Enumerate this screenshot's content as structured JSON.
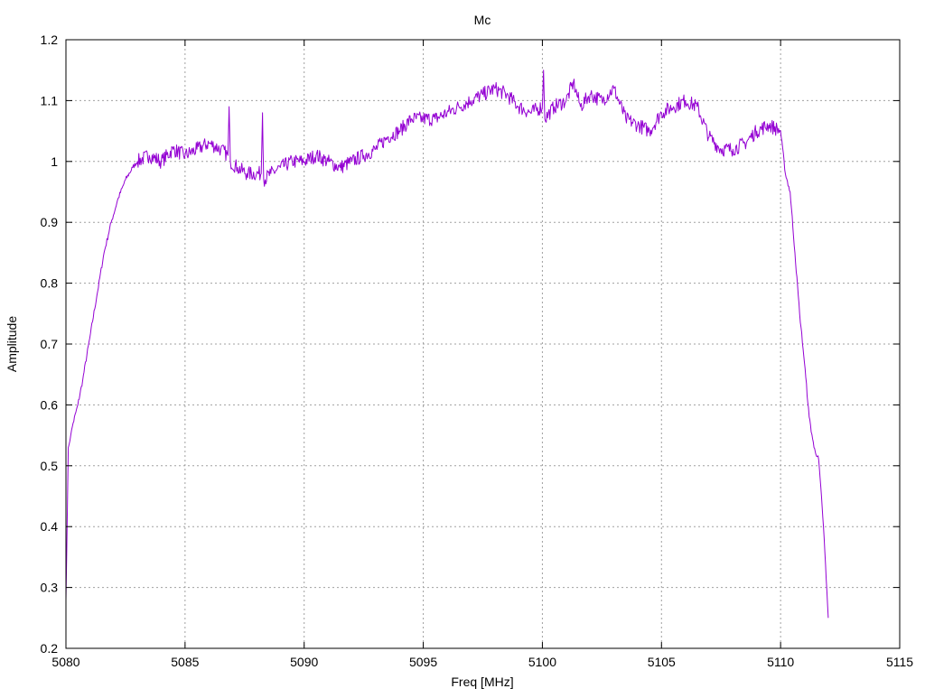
{
  "chart_data": {
    "type": "line",
    "title": "Mc",
    "xlabel": "Freq [MHz]",
    "ylabel": "Amplitude",
    "xlim": [
      5080,
      5115
    ],
    "ylim": [
      0.2,
      1.2
    ],
    "x_ticks": [
      5080,
      5085,
      5090,
      5095,
      5100,
      5105,
      5110,
      5115
    ],
    "y_ticks": [
      0.2,
      0.3,
      0.4,
      0.5,
      0.6,
      0.7,
      0.8,
      0.9,
      1.0,
      1.1,
      1.2
    ],
    "x_tick_labels": [
      "5080",
      "5085",
      "5090",
      "5095",
      "5100",
      "5105",
      "5110",
      "5115"
    ],
    "y_tick_labels": [
      "0.2",
      "0.3",
      "0.4",
      "0.5",
      "0.6",
      "0.7",
      "0.8",
      "0.9",
      "1",
      "1.1",
      "1.2"
    ],
    "grid": true,
    "legend": "none",
    "colors": {
      "series": "#9400d3",
      "grid": "#a0a0a0",
      "axes": "#000000"
    },
    "series": [
      {
        "x": [
          5080.0,
          5080.1,
          5080.2,
          5080.3,
          5080.5,
          5080.7,
          5081.0,
          5081.3,
          5081.6,
          5081.9,
          5082.2,
          5082.5,
          5082.8,
          5083.0,
          5083.5,
          5084.0,
          5084.5,
          5085.0,
          5085.5,
          5086.0,
          5086.5,
          5086.8,
          5086.85,
          5086.9,
          5087.2,
          5087.6,
          5088.0,
          5088.2,
          5088.25,
          5088.3,
          5088.6,
          5089.0,
          5089.5,
          5090.0,
          5090.5,
          5091.0,
          5091.5,
          5092.0,
          5092.5,
          5093.0,
          5093.5,
          5094.0,
          5094.5,
          5095.0,
          5095.5,
          5096.0,
          5096.5,
          5097.0,
          5097.5,
          5098.0,
          5098.5,
          5099.0,
          5099.5,
          5100.0,
          5100.05,
          5100.1,
          5100.5,
          5101.0,
          5101.3,
          5101.6,
          5102.0,
          5102.5,
          5103.0,
          5103.5,
          5104.0,
          5104.5,
          5105.0,
          5105.5,
          5106.0,
          5106.5,
          5107.0,
          5107.5,
          5108.0,
          5108.5,
          5109.0,
          5109.5,
          5110.0,
          5110.2,
          5110.4,
          5110.6,
          5110.8,
          5111.0,
          5111.2,
          5111.4,
          5111.6,
          5111.8,
          5112.0
        ],
        "y": [
          0.28,
          0.53,
          0.55,
          0.57,
          0.6,
          0.64,
          0.71,
          0.78,
          0.85,
          0.9,
          0.94,
          0.97,
          0.99,
          1.0,
          1.01,
          1.0,
          1.02,
          1.01,
          1.02,
          1.03,
          1.02,
          1.01,
          1.09,
          1.0,
          0.99,
          0.98,
          0.98,
          0.98,
          1.08,
          0.97,
          0.98,
          0.99,
          1.0,
          1.0,
          1.01,
          1.0,
          0.99,
          1.0,
          1.01,
          1.02,
          1.04,
          1.05,
          1.07,
          1.07,
          1.07,
          1.08,
          1.09,
          1.1,
          1.11,
          1.12,
          1.11,
          1.09,
          1.08,
          1.09,
          1.15,
          1.07,
          1.09,
          1.1,
          1.13,
          1.09,
          1.11,
          1.1,
          1.12,
          1.07,
          1.06,
          1.05,
          1.08,
          1.09,
          1.1,
          1.09,
          1.04,
          1.02,
          1.02,
          1.03,
          1.05,
          1.06,
          1.05,
          0.98,
          0.95,
          0.85,
          0.75,
          0.67,
          0.58,
          0.53,
          0.51,
          0.4,
          0.25
        ]
      }
    ]
  }
}
